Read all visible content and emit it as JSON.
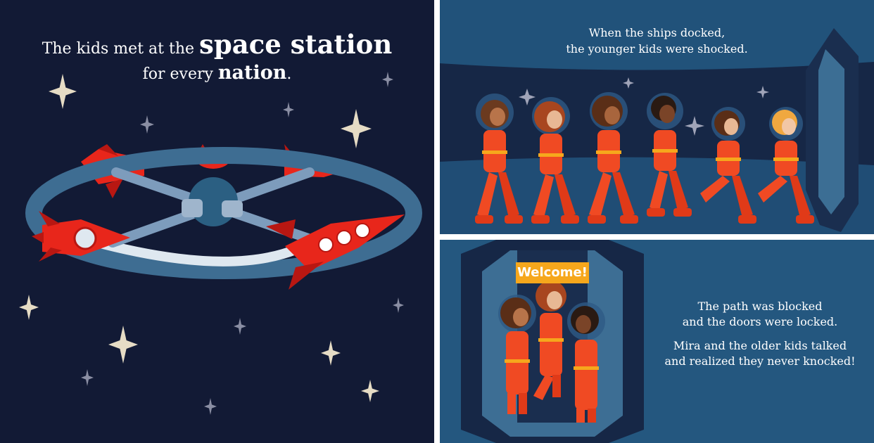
{
  "pages": {
    "left": {
      "line1_prefix": "The kids met at the",
      "line1_emphasis": "space station",
      "line2_prefix": "for every",
      "line2_emphasis": "nation",
      "line2_suffix": "."
    },
    "top_right": {
      "line1": "When the ships docked,",
      "line2": "the younger kids were shocked."
    },
    "bottom_right": {
      "sign": "Welcome!",
      "para1_line1": "The path was blocked",
      "para1_line2": "and the doors were locked.",
      "para2_line1": "Mira and the older kids talked",
      "para2_line2": "and realized they never knocked!"
    }
  },
  "colors": {
    "space_bg": "#121a35",
    "corridor_bg": "#21527a",
    "suit": "#f04a23",
    "rocket_red": "#e8261b",
    "station_ring": "#3e6d92",
    "star": "#e6dcc5",
    "sign": "#f6a71c"
  }
}
